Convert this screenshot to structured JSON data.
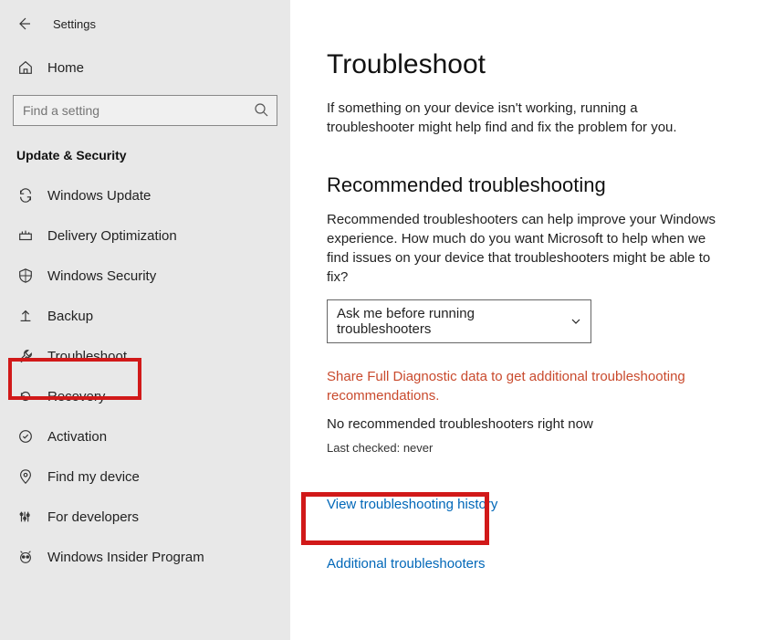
{
  "header": {
    "title": "Settings"
  },
  "sidebar": {
    "home_label": "Home",
    "search_placeholder": "Find a setting",
    "section_title": "Update & Security",
    "items": [
      {
        "label": "Windows Update"
      },
      {
        "label": "Delivery Optimization"
      },
      {
        "label": "Windows Security"
      },
      {
        "label": "Backup"
      },
      {
        "label": "Troubleshoot"
      },
      {
        "label": "Recovery"
      },
      {
        "label": "Activation"
      },
      {
        "label": "Find my device"
      },
      {
        "label": "For developers"
      },
      {
        "label": "Windows Insider Program"
      }
    ]
  },
  "main": {
    "title": "Troubleshoot",
    "description": "If something on your device isn't working, running a troubleshooter might help find and fix the problem for you.",
    "rec_title": "Recommended troubleshooting",
    "rec_desc": "Recommended troubleshooters can help improve your Windows experience. How much do you want Microsoft to help when we find issues on your device that troubleshooters might be able to fix?",
    "dropdown_value": "Ask me before running troubleshooters",
    "alert": "Share Full Diagnostic data to get additional troubleshooting recommendations.",
    "no_rec": "No recommended troubleshooters right now",
    "last_checked": "Last checked: never",
    "history_link": "View troubleshooting history",
    "additional_link": "Additional troubleshooters"
  }
}
